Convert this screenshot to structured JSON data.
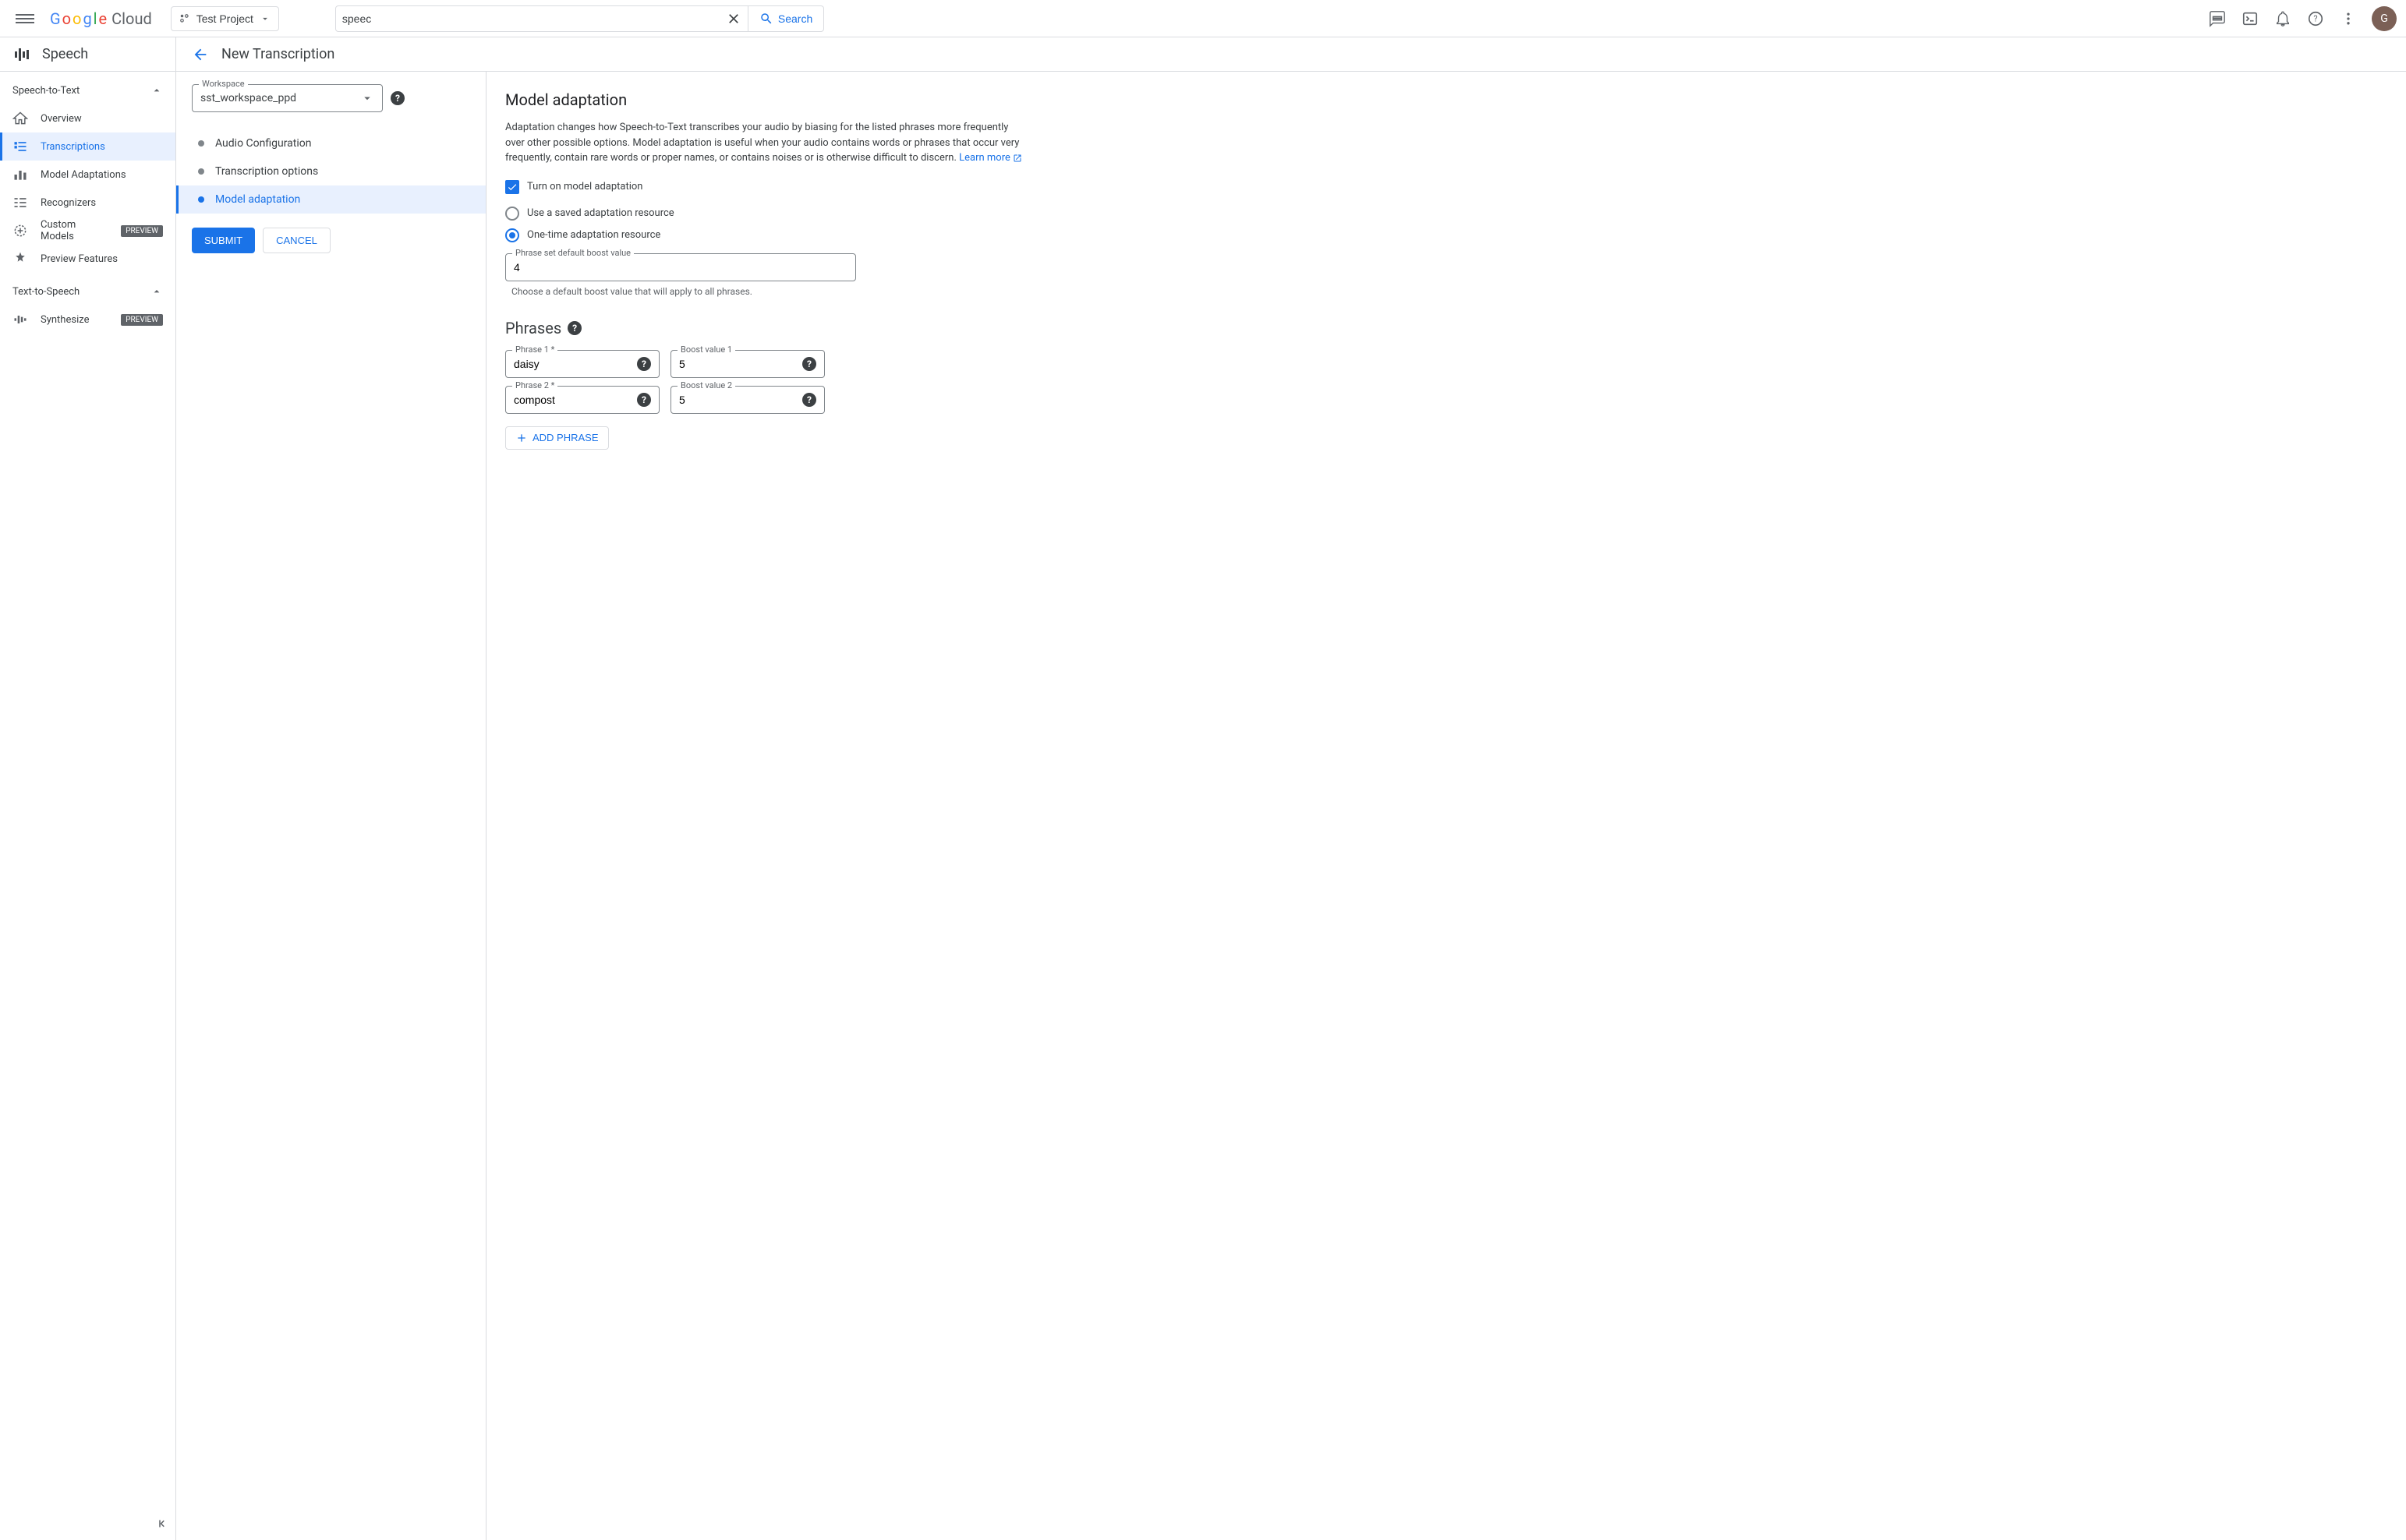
{
  "topbar": {
    "project_label": "Test Project",
    "search_value": "speec",
    "search_button": "Search",
    "avatar_letter": "G"
  },
  "sidebar": {
    "product_title": "Speech",
    "groups": [
      {
        "label": "Speech-to-Text",
        "items": [
          {
            "label": "Overview"
          },
          {
            "label": "Transcriptions",
            "active": true
          },
          {
            "label": "Model Adaptations"
          },
          {
            "label": "Recognizers"
          },
          {
            "label": "Custom Models",
            "badge": "PREVIEW"
          },
          {
            "label": "Preview Features"
          }
        ]
      },
      {
        "label": "Text-to-Speech",
        "items": [
          {
            "label": "Synthesize",
            "badge": "PREVIEW"
          }
        ]
      }
    ]
  },
  "page": {
    "title": "New Transcription",
    "workspace_label": "Workspace",
    "workspace_value": "sst_workspace_ppd",
    "steps": [
      {
        "label": "Audio Configuration"
      },
      {
        "label": "Transcription options"
      },
      {
        "label": "Model adaptation",
        "active": true
      }
    ],
    "submit": "SUBMIT",
    "cancel": "CANCEL"
  },
  "adaptation": {
    "heading": "Model adaptation",
    "description": "Adaptation changes how Speech-to-Text transcribes your audio by biasing for the listed phrases more frequently over other possible options. Model adaptation is useful when your audio contains words or phrases that occur very frequently, contain rare words or proper names, or contains noises or is otherwise difficult to discern. ",
    "learn_more": "Learn more",
    "toggle_label": "Turn on model adaptation",
    "radio_saved": "Use a saved adaptation resource",
    "radio_onetime": "One-time adaptation resource",
    "boost_label": "Phrase set default boost value",
    "boost_value": "4",
    "boost_helper": "Choose a default boost value that will apply to all phrases.",
    "phrases_heading": "Phrases",
    "phrases": [
      {
        "phrase_label": "Phrase 1 *",
        "phrase_value": "daisy",
        "boost_label": "Boost value 1",
        "boost_value": "5"
      },
      {
        "phrase_label": "Phrase 2 *",
        "phrase_value": "compost",
        "boost_label": "Boost value 2",
        "boost_value": "5"
      }
    ],
    "add_phrase": "ADD PHRASE"
  }
}
